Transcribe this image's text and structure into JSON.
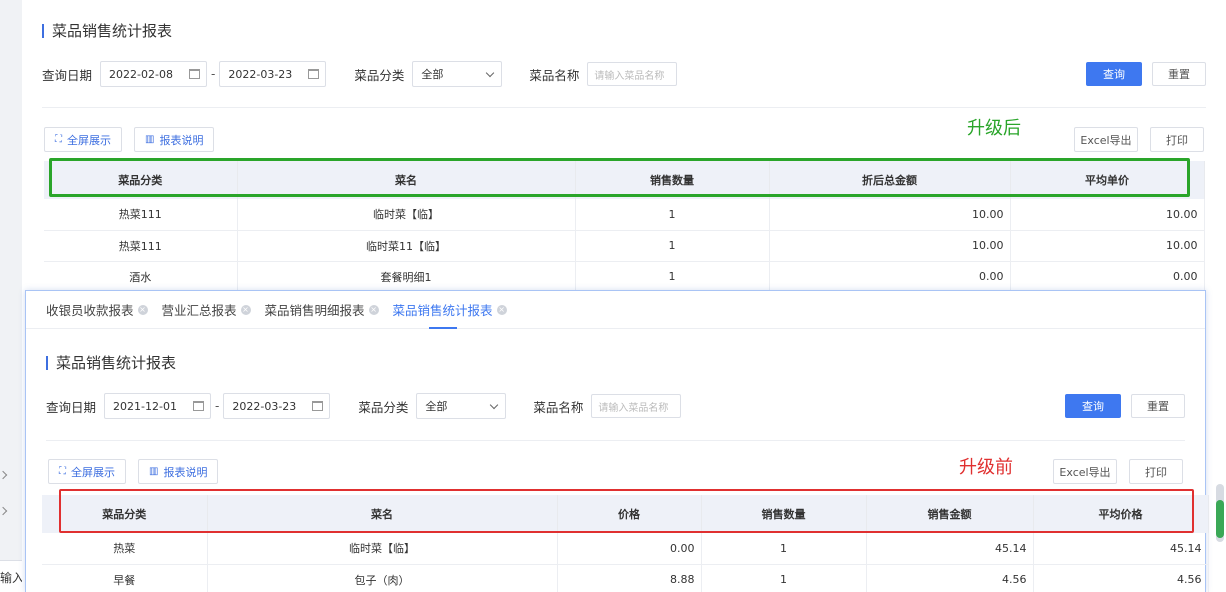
{
  "colors": {
    "primary": "#3e78f0",
    "after_box": "#2aa52a",
    "before_box": "#e03030"
  },
  "after": {
    "title": "菜品销售统计报表",
    "filters": {
      "date_label": "查询日期",
      "date_start": "2022-02-08",
      "date_end": "2022-03-23",
      "category_label": "菜品分类",
      "category_value": "全部",
      "name_label": "菜品名称",
      "name_placeholder": "请输入菜品名称",
      "query_btn": "查询",
      "reset_btn": "重置"
    },
    "tools": {
      "fullscreen": "全屏展示",
      "explain": "报表说明",
      "excel": "Excel导出",
      "print": "打印"
    },
    "annotation": "升级后",
    "columns": [
      "菜品分类",
      "菜名",
      "销售数量",
      "折后总金额",
      "平均单价"
    ],
    "rows": [
      [
        "热菜111",
        "临时菜【临】",
        "1",
        "10.00",
        "10.00"
      ],
      [
        "热菜111",
        "临时菜11【临】",
        "1",
        "10.00",
        "10.00"
      ],
      [
        "酒水",
        "套餐明细1",
        "1",
        "0.00",
        "0.00"
      ]
    ]
  },
  "before": {
    "tabs": [
      {
        "label": "收银员收款报表"
      },
      {
        "label": "营业汇总报表"
      },
      {
        "label": "菜品销售明细报表"
      },
      {
        "label": "菜品销售统计报表"
      }
    ],
    "title": "菜品销售统计报表",
    "filters": {
      "date_label": "查询日期",
      "date_start": "2021-12-01",
      "date_end": "2022-03-23",
      "category_label": "菜品分类",
      "category_value": "全部",
      "name_label": "菜品名称",
      "name_placeholder": "请输入菜品名称",
      "query_btn": "查询",
      "reset_btn": "重置"
    },
    "tools": {
      "fullscreen": "全屏展示",
      "explain": "报表说明",
      "excel": "Excel导出",
      "print": "打印"
    },
    "annotation": "升级前",
    "columns": [
      "菜品分类",
      "菜名",
      "价格",
      "销售数量",
      "销售金额",
      "平均价格"
    ],
    "rows": [
      [
        "热菜",
        "临时菜【临】",
        "0.00",
        "1",
        "45.14",
        "45.14"
      ],
      [
        "早餐",
        "包子（肉）",
        "8.88",
        "1",
        "4.56",
        "4.56"
      ]
    ]
  },
  "background": {
    "left_input_text": "输入优"
  }
}
